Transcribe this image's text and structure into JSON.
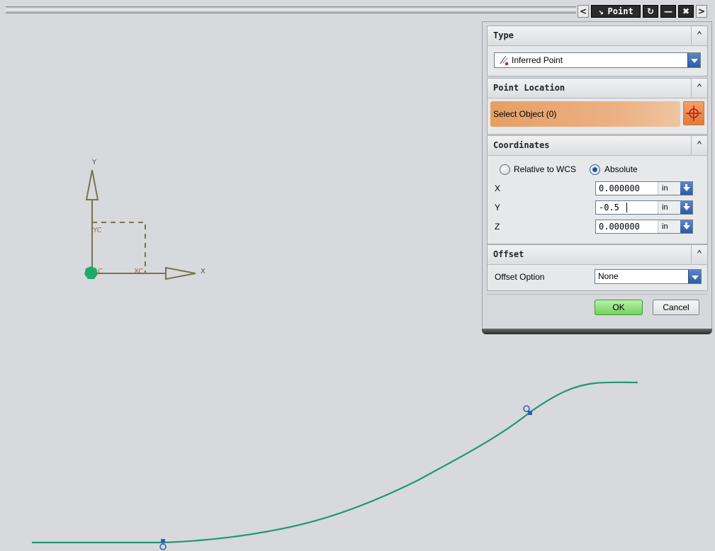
{
  "dialog": {
    "title": "Point",
    "sections": {
      "type": {
        "heading": "Type",
        "selected": "Inferred Point"
      },
      "point_location": {
        "heading": "Point Location",
        "select_label": "Select Object (0)"
      },
      "coordinates": {
        "heading": "Coordinates",
        "radio_relative": "Relative to WCS",
        "radio_absolute": "Absolute",
        "selected_mode": "Absolute",
        "x_label": "X",
        "x_value": "0.000000",
        "x_unit": "in",
        "y_label": "Y",
        "y_value": "-0.5",
        "y_unit": "in",
        "z_label": "Z",
        "z_value": "0.000000",
        "z_unit": "in"
      },
      "offset": {
        "heading": "Offset",
        "option_label": "Offset Option",
        "option_value": "None"
      }
    },
    "ok_label": "OK",
    "cancel_label": "Cancel"
  },
  "viewport": {
    "axis_y_label": "Y",
    "axis_x_label": "X",
    "yc_label": "YC",
    "xc_label": "XC",
    "zc_label": "C"
  },
  "colors": {
    "accent_blue": "#2d5aa4",
    "curve_green": "#1f9a72",
    "wcs_olive": "#7a7352",
    "select_orange": "#e8a46c"
  }
}
